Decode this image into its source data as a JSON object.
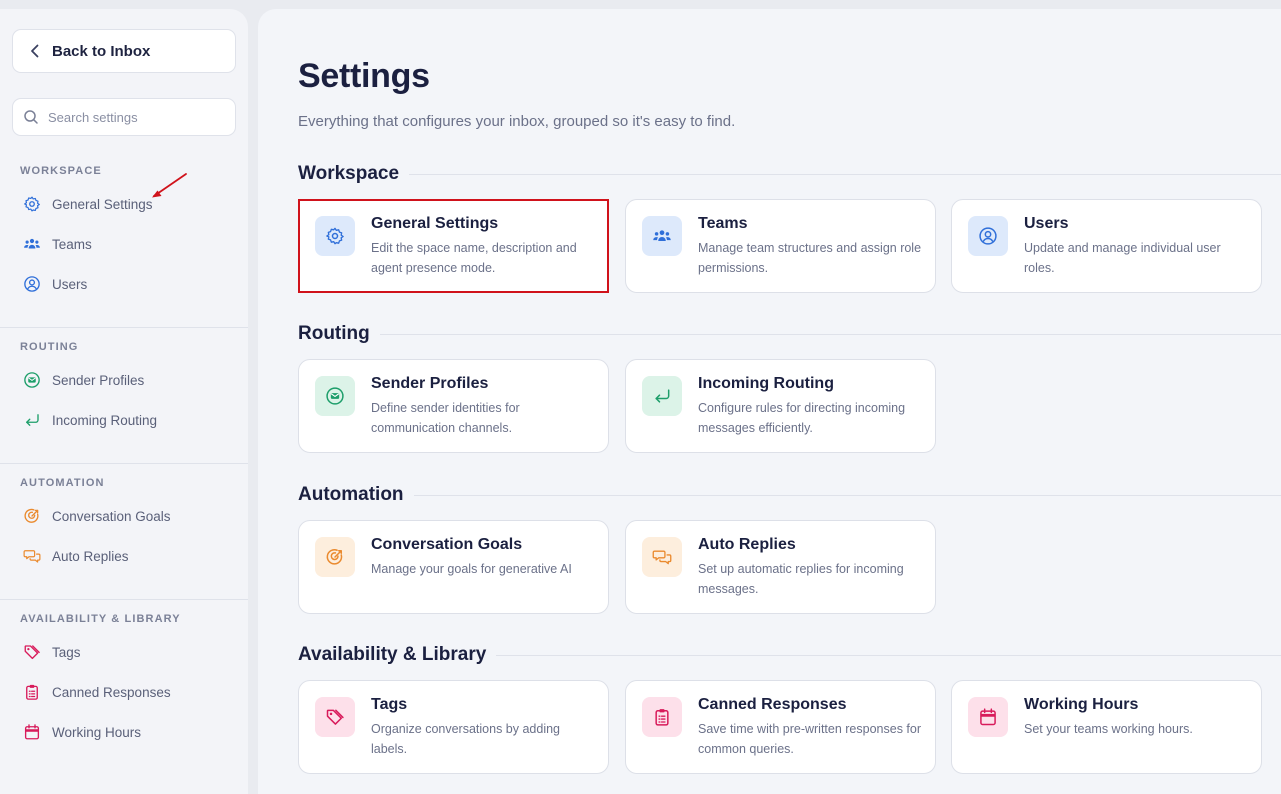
{
  "colors": {
    "blue_icon": "#2f6fd9",
    "blue_bg": "#dde9fb",
    "green_icon": "#1d9e6a",
    "green_bg": "#dcf3e8",
    "orange_icon": "#ea8a2e",
    "orange_bg": "#fdeedd",
    "pink_icon": "#d81b5b",
    "pink_bg": "#fde0ea",
    "selection": "#d0121b"
  },
  "sidebar": {
    "back_label": "Back to Inbox",
    "search_placeholder": "Search settings",
    "groups": [
      {
        "heading": "WORKSPACE",
        "items": [
          {
            "label": "General Settings",
            "icon": "gear-icon"
          },
          {
            "label": "Teams",
            "icon": "team-icon"
          },
          {
            "label": "Users",
            "icon": "user-circle-icon"
          }
        ]
      },
      {
        "heading": "ROUTING",
        "items": [
          {
            "label": "Sender Profiles",
            "icon": "mail-circle-icon"
          },
          {
            "label": "Incoming Routing",
            "icon": "return-arrow-icon"
          }
        ]
      },
      {
        "heading": "AUTOMATION",
        "items": [
          {
            "label": "Conversation Goals",
            "icon": "target-icon"
          },
          {
            "label": "Auto Replies",
            "icon": "chat-bubbles-icon"
          }
        ]
      },
      {
        "heading": "AVAILABILITY & LIBRARY",
        "items": [
          {
            "label": "Tags",
            "icon": "tag-icon"
          },
          {
            "label": "Canned Responses",
            "icon": "clipboard-icon"
          },
          {
            "label": "Working Hours",
            "icon": "calendar-icon"
          }
        ]
      }
    ]
  },
  "main": {
    "title": "Settings",
    "subtitle": "Everything that configures your inbox, grouped so it's easy to find.",
    "sections": [
      {
        "title": "Workspace",
        "cards": [
          {
            "title": "General Settings",
            "desc": "Edit the space name, description and agent presence mode.",
            "icon": "gear-icon"
          },
          {
            "title": "Teams",
            "desc": "Manage team structures and assign role permissions.",
            "icon": "team-icon"
          },
          {
            "title": "Users",
            "desc": "Update and manage individual user roles.",
            "icon": "user-circle-icon"
          }
        ]
      },
      {
        "title": "Routing",
        "cards": [
          {
            "title": "Sender Profiles",
            "desc": "Define sender identities for communication channels.",
            "icon": "mail-circle-icon"
          },
          {
            "title": "Incoming Routing",
            "desc": "Configure rules for directing incoming messages efficiently.",
            "icon": "return-arrow-icon"
          }
        ]
      },
      {
        "title": "Automation",
        "cards": [
          {
            "title": "Conversation Goals",
            "desc": "Manage your goals for generative AI",
            "icon": "target-icon"
          },
          {
            "title": "Auto Replies",
            "desc": "Set up automatic replies for incoming messages.",
            "icon": "chat-bubbles-icon"
          }
        ]
      },
      {
        "title": "Availability & Library",
        "cards": [
          {
            "title": "Tags",
            "desc": "Organize conversations by adding labels.",
            "icon": "tag-icon"
          },
          {
            "title": "Canned Responses",
            "desc": "Save time with pre-written responses for common queries.",
            "icon": "clipboard-icon"
          },
          {
            "title": "Working Hours",
            "desc": "Set your teams working hours.",
            "icon": "calendar-icon"
          }
        ]
      }
    ]
  }
}
